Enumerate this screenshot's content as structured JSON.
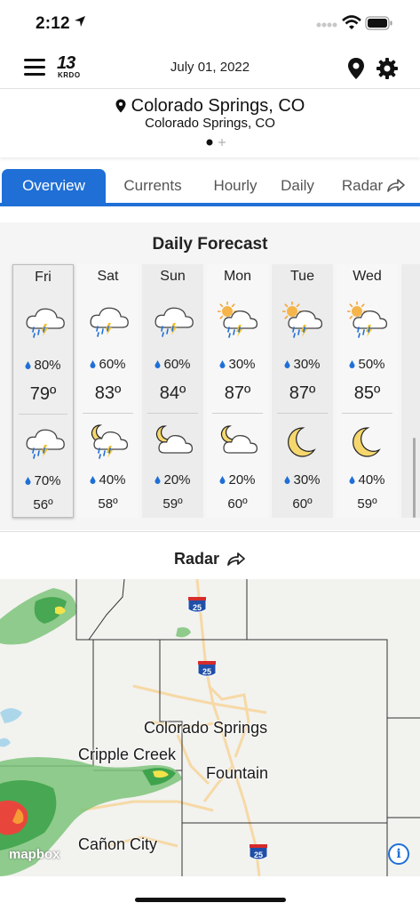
{
  "status_bar": {
    "time": "2:12"
  },
  "header": {
    "date": "July 01, 2022",
    "logo_number": "13",
    "logo_sub": "KRDO"
  },
  "location": {
    "name": "Colorado Springs, CO",
    "subtitle": "Colorado Springs, CO"
  },
  "tabs": [
    {
      "label": "Overview",
      "active": true
    },
    {
      "label": "Currents",
      "active": false
    },
    {
      "label": "Hourly",
      "active": false
    },
    {
      "label": "Daily",
      "active": false
    },
    {
      "label": "Radar",
      "active": false
    }
  ],
  "forecast": {
    "title": "Daily Forecast",
    "days": [
      {
        "name": "Fri",
        "hi_icon": "thunder-rain-icon",
        "hi_precip": "80%",
        "hi": "79º",
        "lo_icon": "thunder-rain-icon",
        "lo_precip": "70%",
        "lo": "56º"
      },
      {
        "name": "Sat",
        "hi_icon": "thunder-rain-icon",
        "hi_precip": "60%",
        "hi": "83º",
        "lo_icon": "moon-thunder-icon",
        "lo_precip": "40%",
        "lo": "58º"
      },
      {
        "name": "Sun",
        "hi_icon": "thunder-rain-icon",
        "hi_precip": "60%",
        "hi": "84º",
        "lo_icon": "moon-cloud-icon",
        "lo_precip": "20%",
        "lo": "59º"
      },
      {
        "name": "Mon",
        "hi_icon": "sun-thunder-icon",
        "hi_precip": "30%",
        "hi": "87º",
        "lo_icon": "moon-cloud-icon",
        "lo_precip": "20%",
        "lo": "60º"
      },
      {
        "name": "Tue",
        "hi_icon": "sun-thunder-icon",
        "hi_precip": "30%",
        "hi": "87º",
        "lo_icon": "moon-icon",
        "lo_precip": "30%",
        "lo": "60º"
      },
      {
        "name": "Wed",
        "hi_icon": "sun-thunder-icon",
        "hi_precip": "50%",
        "hi": "85º",
        "lo_icon": "moon-icon",
        "lo_precip": "40%",
        "lo": "59º"
      }
    ]
  },
  "radar": {
    "title": "Radar",
    "cities": [
      "Colorado Springs",
      "Cripple Creek",
      "Fountain",
      "Cañon City"
    ],
    "highway_label": "25",
    "attribution": "mapbox"
  },
  "colors": {
    "accent": "#1f6fd6",
    "raindrop": "#1f6fd6",
    "moon": "#f5d76e"
  }
}
